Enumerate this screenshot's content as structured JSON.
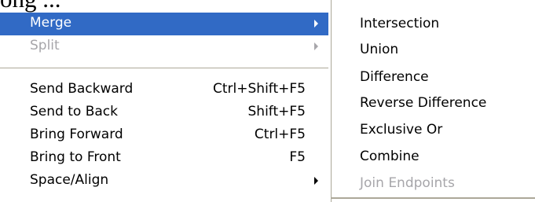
{
  "background_text": "ong ...",
  "menu": {
    "items": [
      {
        "label": "Merge",
        "shortcut": "",
        "submenu": true,
        "state": "highlighted"
      },
      {
        "label": "Split",
        "shortcut": "",
        "submenu": true,
        "state": "disabled"
      },
      {
        "label": "Send Backward",
        "shortcut": "Ctrl+Shift+F5",
        "submenu": false,
        "state": "normal"
      },
      {
        "label": "Send to Back",
        "shortcut": "Shift+F5",
        "submenu": false,
        "state": "normal"
      },
      {
        "label": "Bring Forward",
        "shortcut": "Ctrl+F5",
        "submenu": false,
        "state": "normal"
      },
      {
        "label": "Bring to Front",
        "shortcut": "F5",
        "submenu": false,
        "state": "normal"
      },
      {
        "label": "Space/Align",
        "shortcut": "",
        "submenu": true,
        "state": "normal"
      }
    ]
  },
  "submenu": {
    "items": [
      {
        "label": "Intersection",
        "state": "normal"
      },
      {
        "label": "Union",
        "state": "normal"
      },
      {
        "label": "Difference",
        "state": "normal"
      },
      {
        "label": "Reverse Difference",
        "state": "normal"
      },
      {
        "label": "Exclusive Or",
        "state": "normal"
      },
      {
        "label": "Combine",
        "state": "normal"
      },
      {
        "label": "Join Endpoints",
        "state": "disabled"
      }
    ]
  },
  "colors": {
    "highlight": "#316ac5",
    "disabled": "#a7a6aa",
    "separator": "#aca899"
  }
}
